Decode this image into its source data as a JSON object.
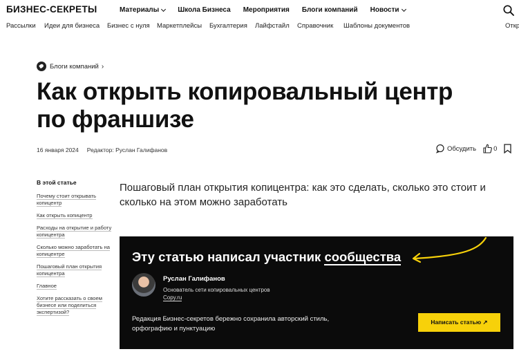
{
  "header": {
    "logo": "БИЗНЕС-СЕКРЕТЫ",
    "nav": [
      {
        "label": "Материалы",
        "has_dropdown": true
      },
      {
        "label": "Школа Бизнеса",
        "has_dropdown": false
      },
      {
        "label": "Мероприятия",
        "has_dropdown": false
      },
      {
        "label": "Блоги компаний",
        "has_dropdown": false
      },
      {
        "label": "Новости",
        "has_dropdown": true
      }
    ],
    "search_icon": "search-icon"
  },
  "subnav": [
    "Рассылки",
    "Идеи для бизнеса",
    "Бизнес с нуля",
    "Маркетплейсы",
    "Бухгалтерия",
    "Лайфстайл",
    "Справочник",
    "Шаблоны документов",
    "Откр"
  ],
  "breadcrumb": {
    "label": "Блоги компаний",
    "icon": "blog-tag-icon"
  },
  "article": {
    "title": "Как открыть копировальный центр по франшизе",
    "date": "16 января 2024",
    "editor": "Редактор: Руслан Галифанов",
    "discuss_label": "Обсудить",
    "likes": "0",
    "lead": "Пошаговый план открытия копицентра: как это сделать, сколько это стоит и сколько на этом можно заработать"
  },
  "toc": {
    "heading": "В этой статье",
    "items": [
      "Почему стоит открывать копицентр",
      "Как открыть копицентр",
      "Расходы на открытие и работу копицентра",
      "Сколько можно заработать на копицентре",
      "Пошаговый план открытия копицентра",
      "Главное",
      "Хотите рассказать о своем бизнесе или поделиться экспертизой?"
    ]
  },
  "community_card": {
    "title_prefix": "Эту статью написал участник ",
    "title_link": "сообщества",
    "author_name": "Руслан Галифанов",
    "author_role_text": "Основатель сети копировальных центров ",
    "author_role_link": "Copy.ru",
    "note": "Редакция Бизнес-секретов бережно сохранила авторский стиль, орфографию и пунктуацию",
    "button": "Написать статью ↗",
    "accent_color": "#f7d10a",
    "background_color": "#0b0b0b"
  }
}
